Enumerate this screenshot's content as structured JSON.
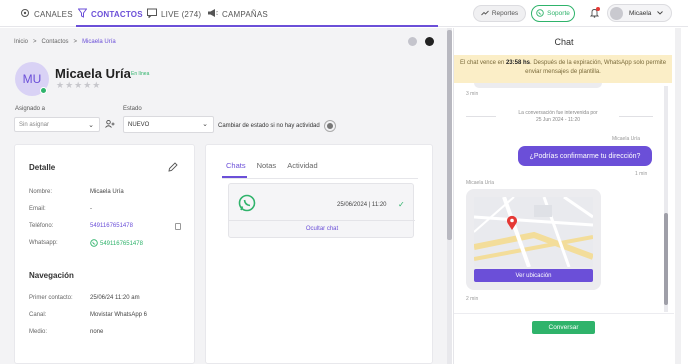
{
  "nav": {
    "canales": "CANALES",
    "contactos": "CONTACTOS",
    "live": "LIVE (274)",
    "campanas": "CAMPAÑAS"
  },
  "top_right": {
    "reportes": "Reportes",
    "soporte": "Soporte",
    "user": "Micaela"
  },
  "breadcrumb": [
    "Inicio",
    ">",
    "Contactos",
    ">",
    "Micaela Uría"
  ],
  "contact": {
    "initials": "MU",
    "name": "Micaela Uría",
    "online": "En línea",
    "stars": "★★★★★"
  },
  "assignment": {
    "assigned_label": "Asignado a",
    "assigned_placeholder": "Sin asignar",
    "state_label": "Estado",
    "state_value": "NUEVO",
    "change_state": "Cambiar de estado si no hay actividad"
  },
  "detalle": {
    "title": "Detalle",
    "rows": [
      {
        "label": "Nombre:",
        "value": "Micaela Uría"
      },
      {
        "label": "Email:",
        "value": "-"
      },
      {
        "label": "Teléfono:",
        "value": "5491167651478"
      },
      {
        "label": "Whatsapp:",
        "value": "5491167651478"
      }
    ]
  },
  "navegacion": {
    "title": "Navegación",
    "rows": [
      {
        "label": "Primer contacto:",
        "value": "25/06/24 11:20 am"
      },
      {
        "label": "Canal:",
        "value": "Movistar WhatsApp 6"
      },
      {
        "label": "Medio:",
        "value": "none"
      }
    ]
  },
  "tabs": [
    "Chats",
    "Notas",
    "Actividad"
  ],
  "chat_item": {
    "date": "25/06/2024 | 11:20",
    "hide": "Ocultar chat"
  },
  "chat_panel": {
    "title": "Chat",
    "warning_pre": "El chat vence en ",
    "warning_time": "23:58 hs",
    "warning_post": ". Después de la expiración, WhatsApp solo permite enviar mensajes de plantilla.",
    "time_top": "3 min",
    "intervened_line1": "La conversación fue intervenida por",
    "intervened_line2": "25 Jun 2024 - 11:20",
    "sender_agent": "Micaela Uría",
    "message_out": "¿Podrías confirmarme tu dirección?",
    "time_out": "1 min",
    "sender_contact": "Micaela Uría",
    "map_button": "Ver ubicación",
    "time_map": "2 min",
    "conversar": "Conversar"
  }
}
